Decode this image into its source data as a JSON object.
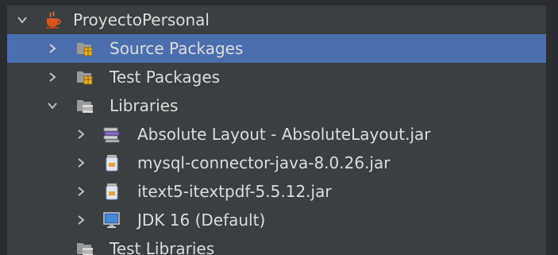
{
  "tree": {
    "project": {
      "label": "ProyectoPersonal",
      "icon": "coffee-cup-icon",
      "expanded": true
    },
    "source_packages": {
      "label": "Source Packages",
      "icon": "package-folder-icon",
      "expanded": false,
      "selected": true
    },
    "test_packages": {
      "label": "Test Packages",
      "icon": "package-folder-icon",
      "expanded": false
    },
    "libraries": {
      "label": "Libraries",
      "icon": "library-folder-icon",
      "expanded": true,
      "items": [
        {
          "label": "Absolute Layout - AbsoluteLayout.jar",
          "icon": "books-icon"
        },
        {
          "label": "mysql-connector-java-8.0.26.jar",
          "icon": "jar-file-icon"
        },
        {
          "label": "itext5-itextpdf-5.5.12.jar",
          "icon": "jar-file-icon"
        },
        {
          "label": "JDK 16 (Default)",
          "icon": "jdk-monitor-icon"
        }
      ]
    },
    "test_libraries": {
      "label": "Test Libraries",
      "icon": "library-folder-icon"
    }
  },
  "colors": {
    "background": "#3c3f41",
    "selection": "#4b6eaf",
    "text": "#dcdcdc"
  }
}
